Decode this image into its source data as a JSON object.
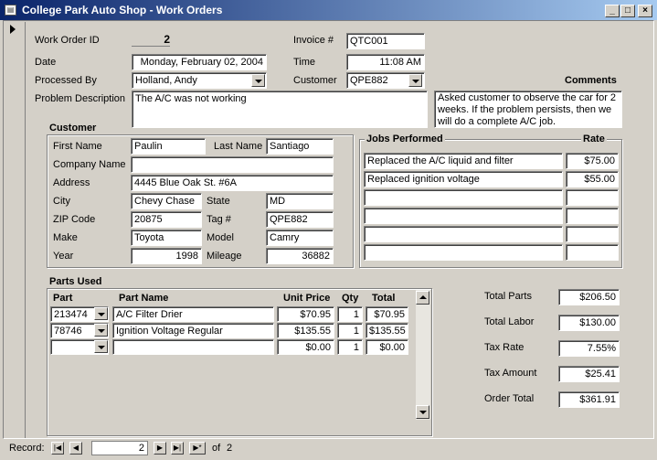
{
  "window": {
    "title": "College Park Auto Shop - Work Orders"
  },
  "header": {
    "work_order_id_label": "Work Order ID",
    "work_order_id": "2",
    "invoice_label": "Invoice #",
    "invoice": "QTC001",
    "date_label": "Date",
    "date": "Monday, February 02, 2004",
    "time_label": "Time",
    "time": "11:08 AM",
    "processed_by_label": "Processed By",
    "processed_by": "Holland, Andy",
    "customer_label": "Customer",
    "customer": "QPE882",
    "problem_label": "Problem Description",
    "problem": "The A/C was not working",
    "comments_label": "Comments",
    "comments": "Asked customer to observe the car for 2 weeks. If the problem persists, then we will do a complete A/C job."
  },
  "customer": {
    "section_title": "Customer",
    "first_name_label": "First Name",
    "first_name": "Paulin",
    "last_name_label": "Last Name",
    "last_name": "Santiago",
    "company_label": "Company Name",
    "company": "",
    "address_label": "Address",
    "address": "4445 Blue Oak St. #6A",
    "city_label": "City",
    "city": "Chevy Chase",
    "state_label": "State",
    "state": "MD",
    "zip_label": "ZIP Code",
    "zip": "20875",
    "tag_label": "Tag #",
    "tag": "QPE882",
    "make_label": "Make",
    "make": "Toyota",
    "model_label": "Model",
    "model": "Camry",
    "year_label": "Year",
    "year": "1998",
    "mileage_label": "Mileage",
    "mileage": "36882"
  },
  "jobs": {
    "section_title": "Jobs Performed",
    "rate_title": "Rate",
    "rows": [
      {
        "job": "Replaced the A/C liquid and filter",
        "rate": "$75.00"
      },
      {
        "job": "Replaced ignition voltage",
        "rate": "$55.00"
      },
      {
        "job": "",
        "rate": ""
      },
      {
        "job": "",
        "rate": ""
      },
      {
        "job": "",
        "rate": ""
      },
      {
        "job": "",
        "rate": ""
      }
    ]
  },
  "parts": {
    "section_title": "Parts Used",
    "columns": {
      "part": "Part",
      "name": "Part Name",
      "unit_price": "Unit Price",
      "qty": "Qty",
      "total": "Total"
    },
    "rows": [
      {
        "part": "213474",
        "name": "A/C Filter Drier",
        "unit_price": "$70.95",
        "qty": "1",
        "total": "$70.95"
      },
      {
        "part": "78746",
        "name": "Ignition Voltage Regular",
        "unit_price": "$135.55",
        "qty": "1",
        "total": "$135.55"
      },
      {
        "part": "",
        "name": "",
        "unit_price": "$0.00",
        "qty": "1",
        "total": "$0.00"
      }
    ]
  },
  "totals": {
    "total_parts_label": "Total Parts",
    "total_parts": "$206.50",
    "total_labor_label": "Total Labor",
    "total_labor": "$130.00",
    "tax_rate_label": "Tax Rate",
    "tax_rate": "7.55%",
    "tax_amount_label": "Tax Amount",
    "tax_amount": "$25.41",
    "order_total_label": "Order Total",
    "order_total": "$361.91"
  },
  "navigation": {
    "record_label": "Record:",
    "current": "2",
    "of_label": "of",
    "total": "2"
  },
  "icons": [
    "app-icon",
    "minimize-icon",
    "maximize-icon",
    "close-icon",
    "record-selector-icon",
    "dropdown-icon",
    "scroll-up-icon",
    "scroll-down-icon",
    "first-record-icon",
    "prev-record-icon",
    "next-record-icon",
    "last-record-icon",
    "new-record-icon"
  ]
}
